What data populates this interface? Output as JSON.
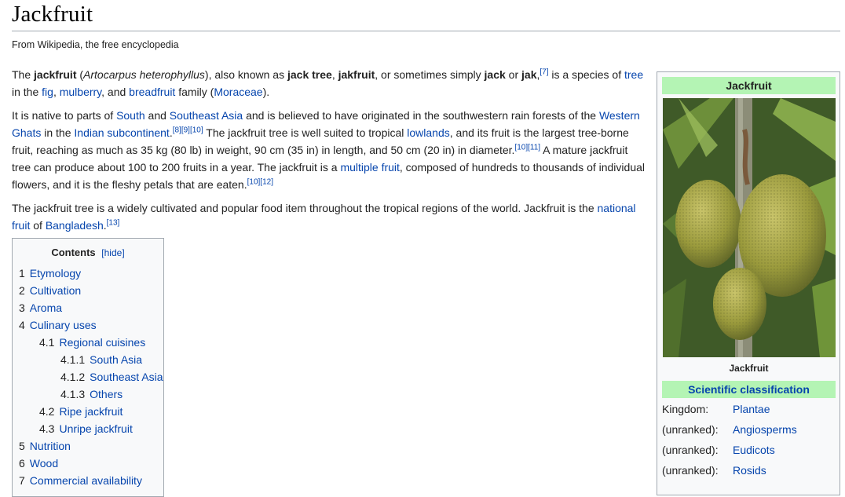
{
  "page": {
    "title": "Jackfruit",
    "tagline": "From Wikipedia, the free encyclopedia"
  },
  "paragraphs": {
    "p1": [
      {
        "t": "The "
      },
      {
        "t": "jackfruit",
        "b": true
      },
      {
        "t": " ("
      },
      {
        "t": "Artocarpus heterophyllus",
        "i": true
      },
      {
        "t": "), also known as "
      },
      {
        "t": "jack tree",
        "b": true
      },
      {
        "t": ", "
      },
      {
        "t": "jakfruit",
        "b": true
      },
      {
        "t": ", or sometimes simply "
      },
      {
        "t": "jack",
        "b": true
      },
      {
        "t": " or "
      },
      {
        "t": "jak",
        "b": true
      },
      {
        "t": ","
      },
      {
        "t": "[7]",
        "sup": true,
        "link": true
      },
      {
        "t": " is a species of "
      },
      {
        "t": "tree",
        "link": true
      },
      {
        "t": " in the "
      },
      {
        "t": "fig",
        "link": true
      },
      {
        "t": ", "
      },
      {
        "t": "mulberry",
        "link": true
      },
      {
        "t": ", and "
      },
      {
        "t": "breadfruit",
        "link": true
      },
      {
        "t": " family ("
      },
      {
        "t": "Moraceae",
        "link": true
      },
      {
        "t": ")."
      }
    ],
    "p2": [
      {
        "t": "It is native to parts of "
      },
      {
        "t": "South",
        "link": true
      },
      {
        "t": " and "
      },
      {
        "t": "Southeast Asia",
        "link": true
      },
      {
        "t": " and is believed to have originated in the southwestern rain forests of the "
      },
      {
        "t": "Western Ghats",
        "link": true
      },
      {
        "t": " in the "
      },
      {
        "t": "Indian subcontinent",
        "link": true
      },
      {
        "t": "."
      },
      {
        "t": "[8][9][10]",
        "sup": true,
        "link": true
      },
      {
        "t": " The jackfruit tree is well suited to tropical "
      },
      {
        "t": "lowlands",
        "link": true
      },
      {
        "t": ", and its fruit is the largest tree-borne fruit, reaching as much as 35 kg (80 lb) in weight, 90 cm (35 in) in length, and 50 cm (20 in) in diameter."
      },
      {
        "t": "[10][11]",
        "sup": true,
        "link": true
      },
      {
        "t": " A mature jackfruit tree can produce about 100 to 200 fruits in a year. The jackfruit is a "
      },
      {
        "t": "multiple fruit",
        "link": true
      },
      {
        "t": ", composed of hundreds to thousands of individual flowers, and it is the fleshy petals that are eaten."
      },
      {
        "t": "[10][12]",
        "sup": true,
        "link": true
      }
    ],
    "p3": [
      {
        "t": "The jackfruit tree is a widely cultivated and popular food item throughout the tropical regions of the world. Jackfruit is the "
      },
      {
        "t": "national fruit",
        "link": true
      },
      {
        "t": " of "
      },
      {
        "t": "Bangladesh",
        "link": true
      },
      {
        "t": "."
      },
      {
        "t": "[13]",
        "sup": true,
        "link": true
      }
    ]
  },
  "toc": {
    "title": "Contents",
    "hide_label": "[hide]",
    "items": [
      {
        "num": "1",
        "label": "Etymology",
        "level": 1
      },
      {
        "num": "2",
        "label": "Cultivation",
        "level": 1
      },
      {
        "num": "3",
        "label": "Aroma",
        "level": 1
      },
      {
        "num": "4",
        "label": "Culinary uses",
        "level": 1
      },
      {
        "num": "4.1",
        "label": "Regional cuisines",
        "level": 2
      },
      {
        "num": "4.1.1",
        "label": "South Asia",
        "level": 3
      },
      {
        "num": "4.1.2",
        "label": "Southeast Asia",
        "level": 3
      },
      {
        "num": "4.1.3",
        "label": "Others",
        "level": 3
      },
      {
        "num": "4.2",
        "label": "Ripe jackfruit",
        "level": 2
      },
      {
        "num": "4.3",
        "label": "Unripe jackfruit",
        "level": 2
      },
      {
        "num": "5",
        "label": "Nutrition",
        "level": 1
      },
      {
        "num": "6",
        "label": "Wood",
        "level": 1
      },
      {
        "num": "7",
        "label": "Commercial availability",
        "level": 1
      }
    ]
  },
  "infobox": {
    "header": "Jackfruit",
    "caption": "Jackfruit",
    "sci_header": "Scientific classification",
    "rows": [
      {
        "key": "Kingdom:",
        "value": "Plantae"
      },
      {
        "key": "(unranked):",
        "value": "Angiosperms"
      },
      {
        "key": "(unranked):",
        "value": "Eudicots"
      },
      {
        "key": "(unranked):",
        "value": "Rosids"
      }
    ]
  },
  "colors": {
    "link": "#0645ad",
    "infobox_header": "#b4f4b4"
  }
}
